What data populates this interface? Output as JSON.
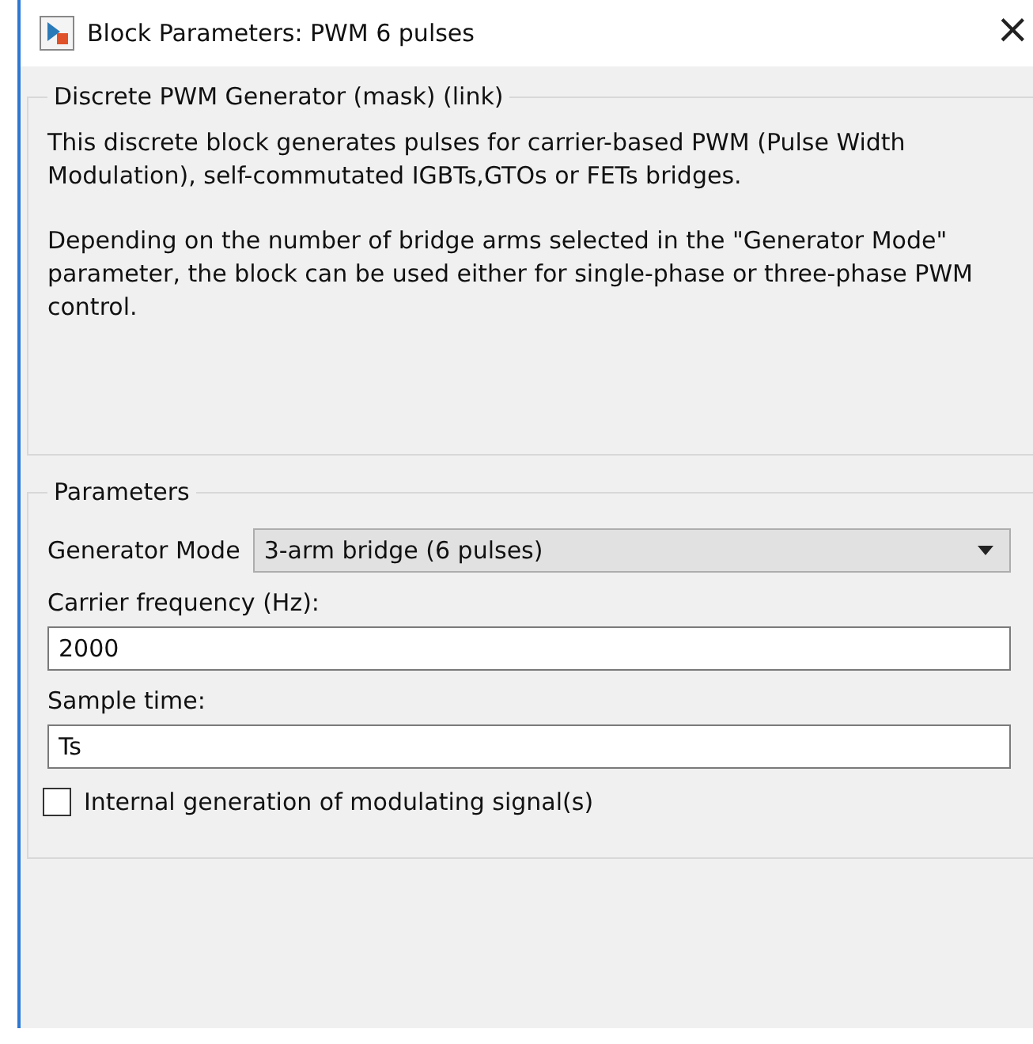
{
  "window": {
    "title": "Block Parameters: PWM 6 pulses",
    "close": "×"
  },
  "description": {
    "title": "Discrete PWM Generator (mask) (link)",
    "paragraphs": [
      "This discrete block generates pulses for carrier-based PWM (Pulse Width Modulation), self-commutated IGBTs,GTOs or FETs bridges.",
      "Depending on the number of bridge arms selected in the \"Generator Mode\" parameter, the block can be used either for single-phase or three-phase PWM control."
    ]
  },
  "parameters": {
    "title": "Parameters",
    "fields": [
      {
        "kind": "dropdown",
        "label": "Generator Mode",
        "value": "3-arm  bridge (6 pulses)"
      },
      {
        "kind": "text",
        "label": "Carrier frequency (Hz):",
        "value": "2000"
      },
      {
        "kind": "text",
        "label": "Sample time:",
        "value": "Ts"
      },
      {
        "kind": "checkbox",
        "label": "Internal generation of modulating signal(s)",
        "checked": false
      }
    ]
  }
}
